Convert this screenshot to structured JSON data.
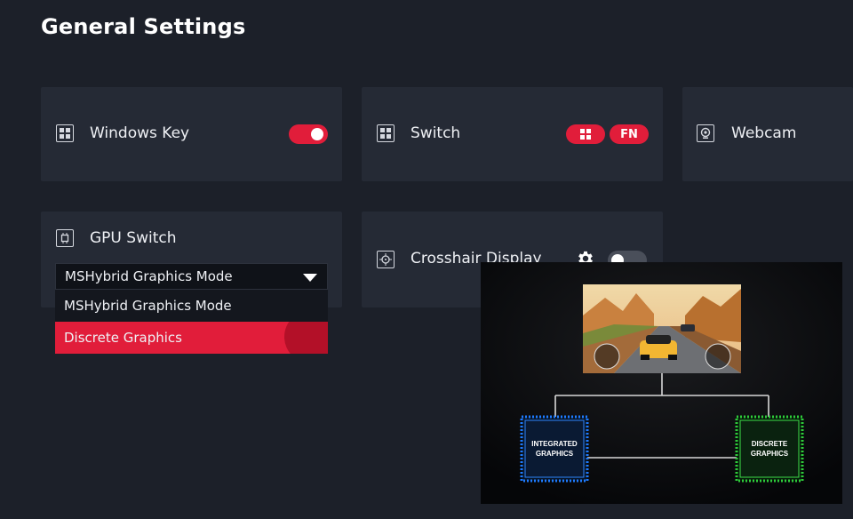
{
  "page": {
    "title": "General Settings"
  },
  "cards": {
    "windows_key": {
      "label": "Windows Key",
      "icon": "windows-icon",
      "toggle_on": true
    },
    "switch": {
      "label": "Switch",
      "icon": "windows-icon",
      "options": [
        "windows-icon",
        "FN"
      ]
    },
    "webcam": {
      "label": "Webcam",
      "icon": "webcam-icon"
    },
    "gpu_switch": {
      "label": "GPU Switch",
      "icon": "chip-icon",
      "selected": "MSHybrid Graphics Mode",
      "options": [
        "MSHybrid Graphics Mode",
        "Discrete Graphics"
      ],
      "highlighted_index": 1
    },
    "crosshair": {
      "label": "Crosshair Display",
      "icon": "crosshair-icon",
      "toggle_on": false
    }
  },
  "diagram": {
    "integrated_label": "INTEGRATED GRAPHICS",
    "discrete_label": "DISCRETE GRAPHICS"
  },
  "colors": {
    "accent": "#e11d3a",
    "background": "#1c2029",
    "card": "#252a35",
    "integrated_glow": "#1e7bff",
    "discrete_glow": "#2ecc3a"
  }
}
